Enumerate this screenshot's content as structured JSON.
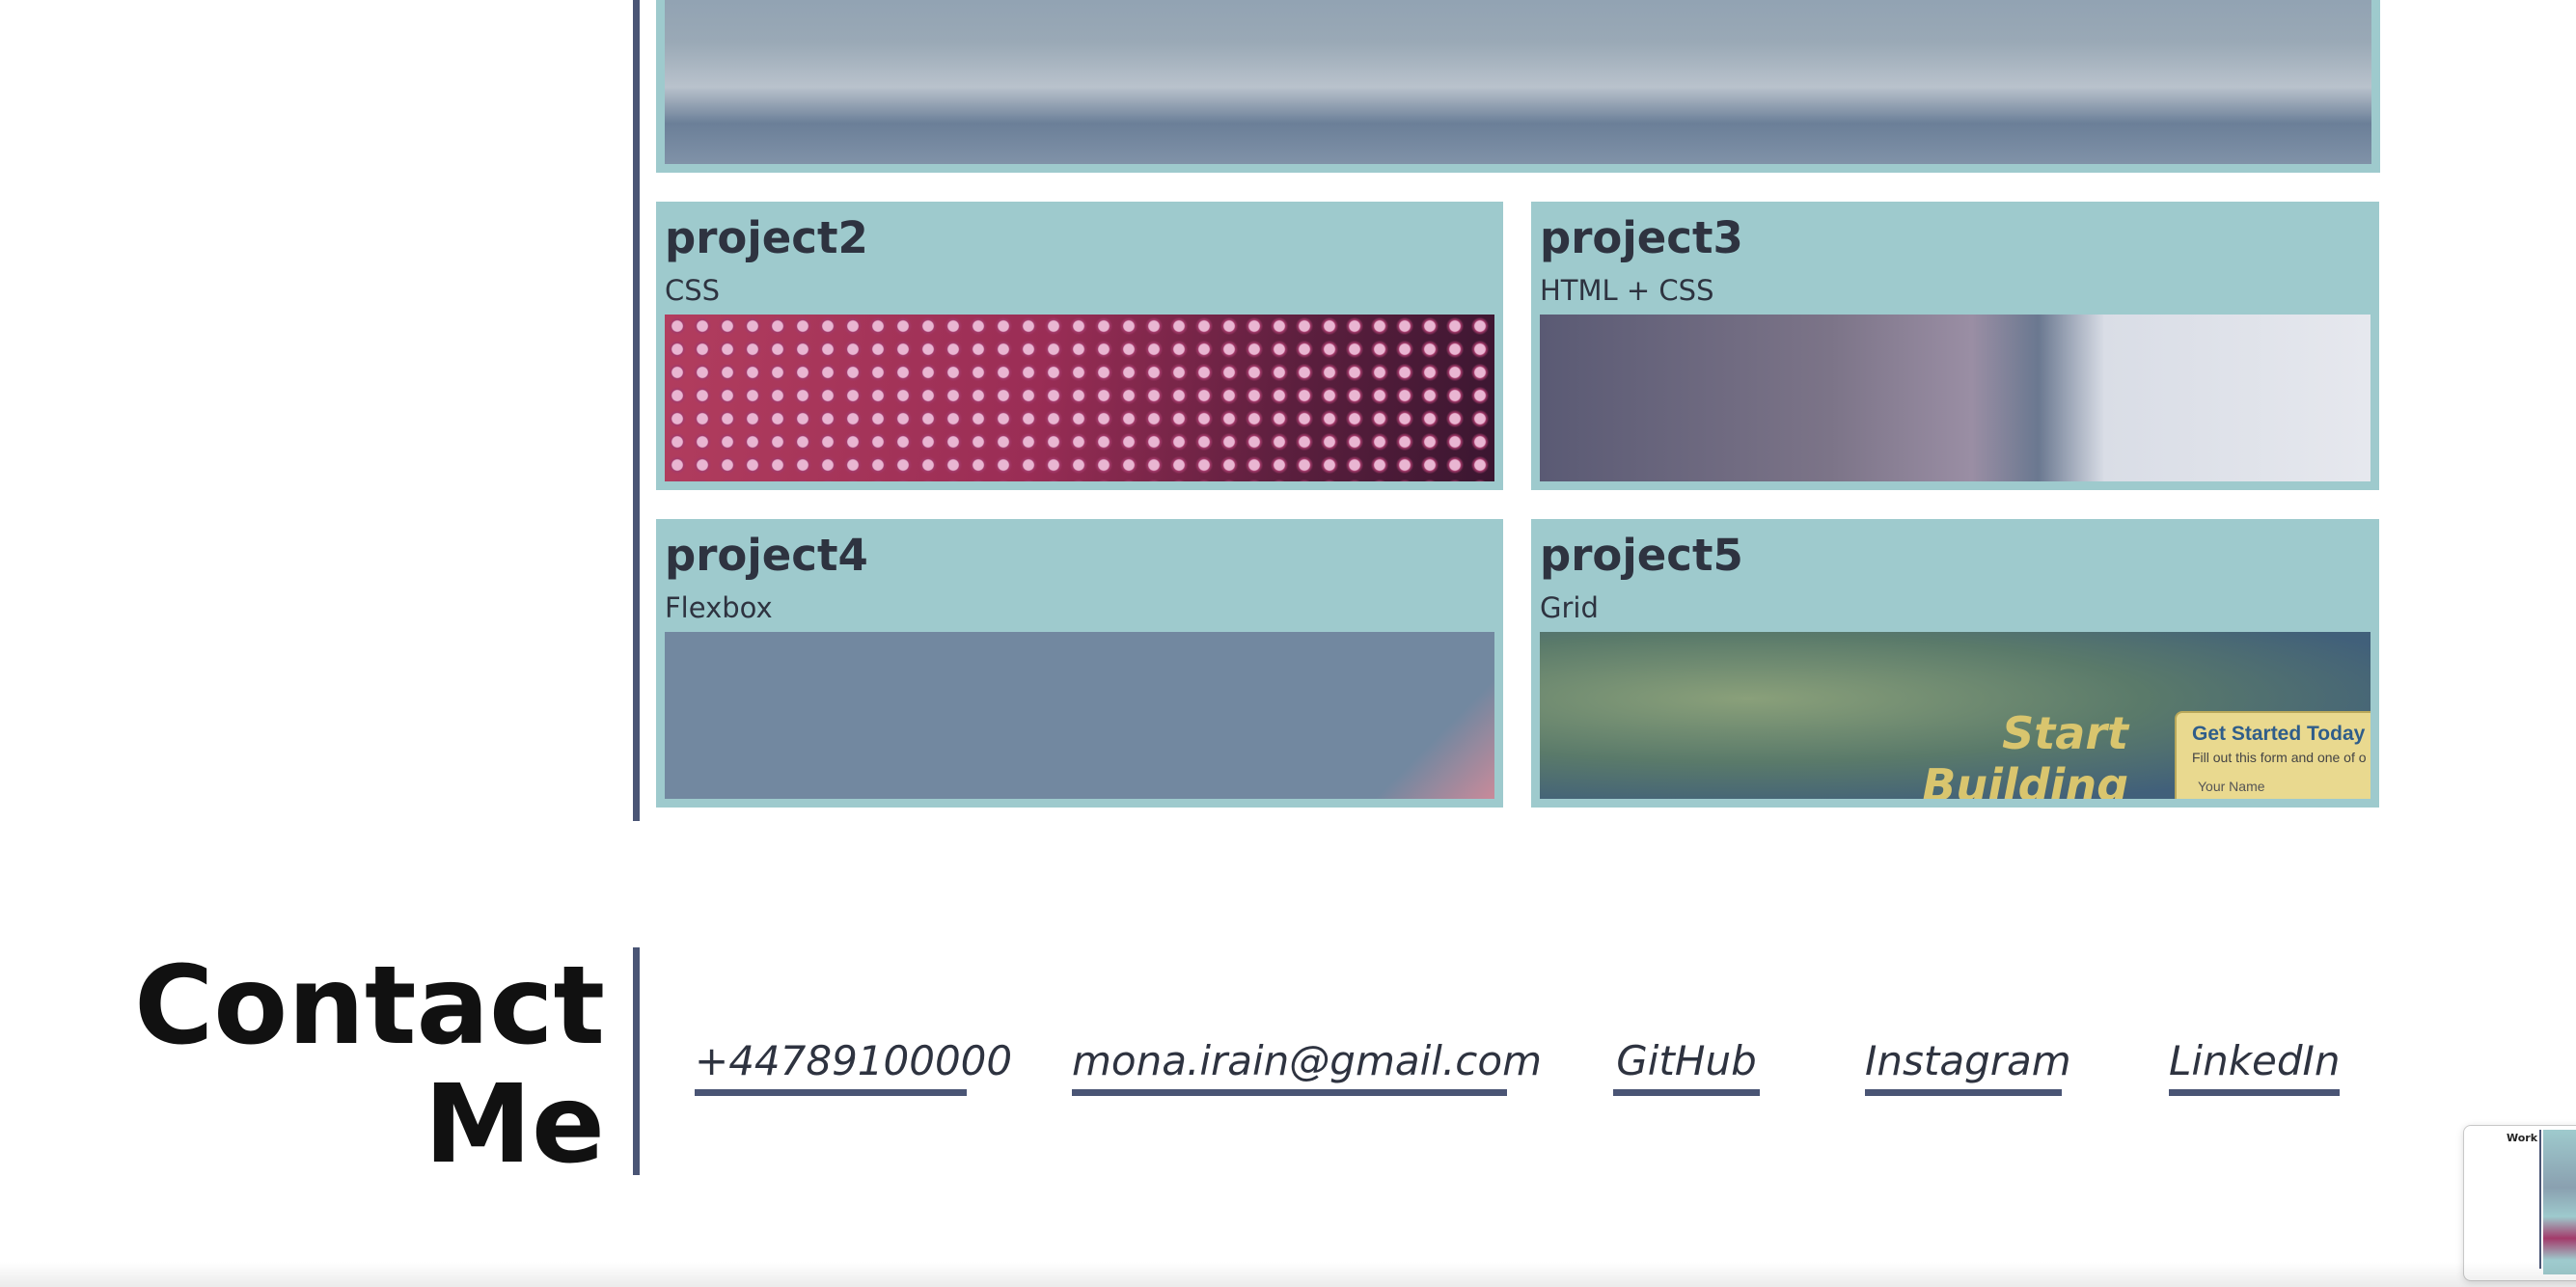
{
  "projects": [
    {
      "title": "project2",
      "subtitle": "CSS"
    },
    {
      "title": "project3",
      "subtitle": "HTML + CSS"
    },
    {
      "title": "project4",
      "subtitle": "Flexbox"
    },
    {
      "title": "project5",
      "subtitle": "Grid"
    }
  ],
  "project5_preview": {
    "headline": "Start Building Habits",
    "form_title": "Get Started Today",
    "form_sub": "Fill out this form and one of o",
    "form_field": "Your Name"
  },
  "contact": {
    "heading_line1": "Contact",
    "heading_line2": "Me",
    "phone": "+44789100000",
    "email": "mona.irain@gmail.com",
    "github": "GitHub",
    "instagram": "Instagram",
    "linkedin": "LinkedIn"
  },
  "thumbnail": {
    "label": "Work"
  },
  "colors": {
    "accent": "#4a5575",
    "card": "#9ecacd",
    "text": "#2e3340"
  }
}
